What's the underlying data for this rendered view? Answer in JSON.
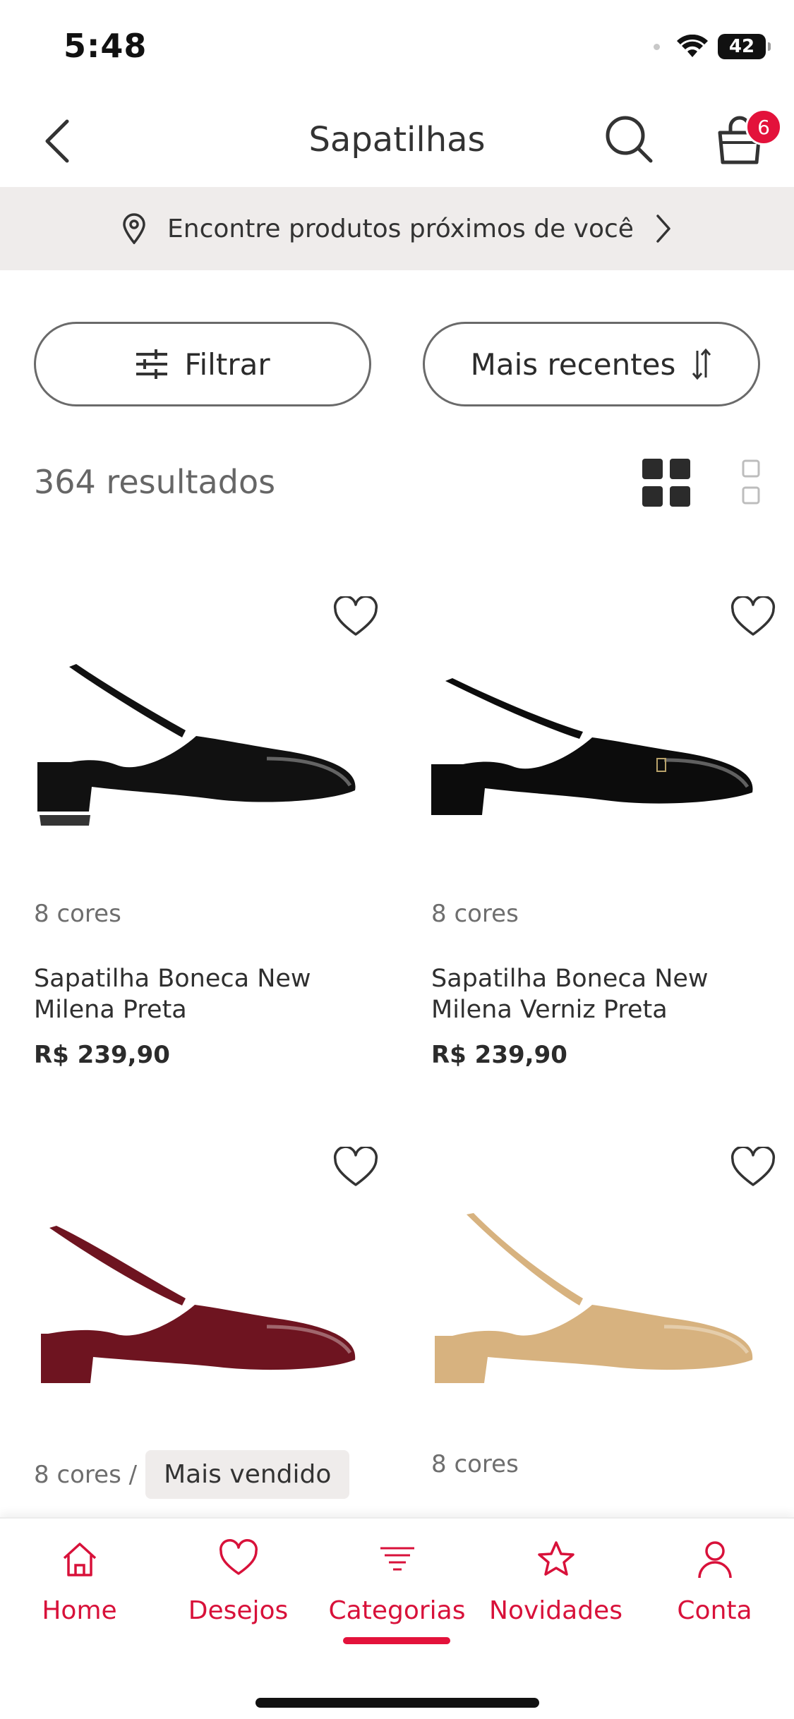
{
  "status_bar": {
    "time": "5:48",
    "battery": "42"
  },
  "header": {
    "title": "Sapatilhas",
    "cart_count": "6"
  },
  "location_bar": {
    "text": "Encontre produtos próximos de você"
  },
  "filters": {
    "filter_label": "Filtrar",
    "sort_label": "Mais recentes"
  },
  "results": {
    "count_text": "364 resultados"
  },
  "products": [
    {
      "colors": "8 cores",
      "name": "Sapatilha Boneca New Milena Preta",
      "price": "R$ 239,90",
      "color": "#111111"
    },
    {
      "colors": "8 cores",
      "name": "Sapatilha Boneca New Milena Verniz Preta",
      "price": "R$ 239,90",
      "color": "#0c0c0c"
    },
    {
      "colors": "8 cores /",
      "badge": "Mais vendido",
      "color": "#6e1420"
    },
    {
      "colors": "8 cores",
      "color": "#d7b27f"
    }
  ],
  "bottom_nav": {
    "items": [
      {
        "label": "Home",
        "icon": "home-icon"
      },
      {
        "label": "Desejos",
        "icon": "heart-icon"
      },
      {
        "label": "Categorias",
        "icon": "categories-icon"
      },
      {
        "label": "Novidades",
        "icon": "star-icon"
      },
      {
        "label": "Conta",
        "icon": "user-icon"
      }
    ],
    "active": "Categorias",
    "accent": "#e3123b"
  }
}
